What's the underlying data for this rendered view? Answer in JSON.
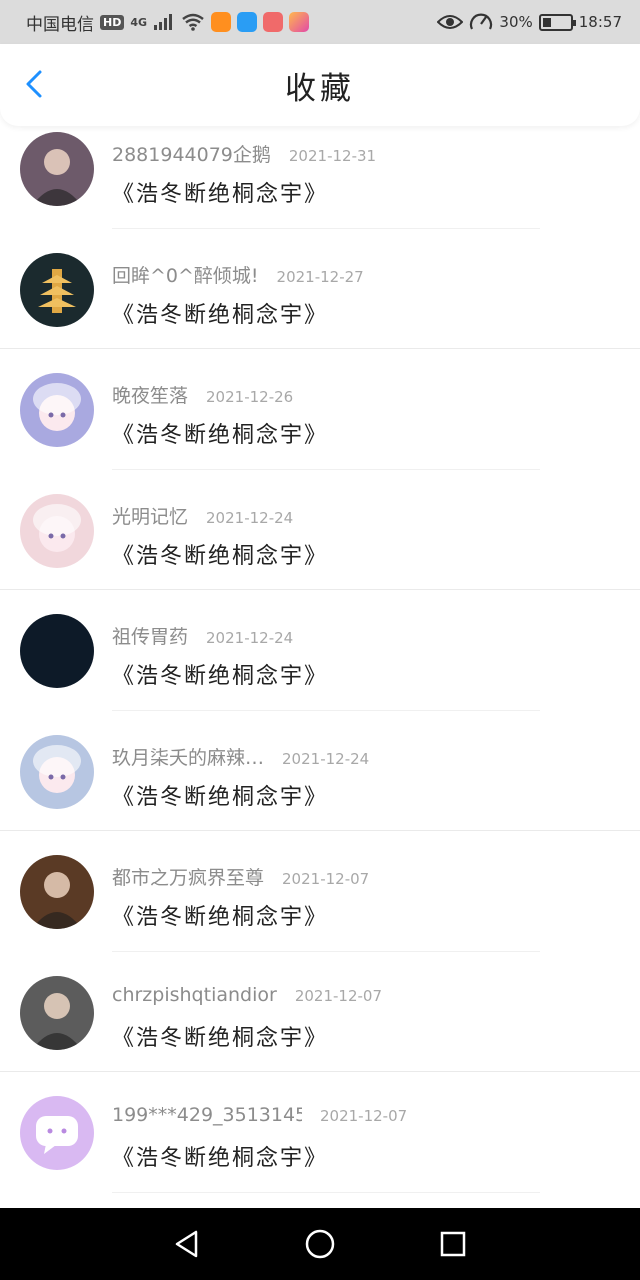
{
  "status_bar": {
    "carrier": "中国电信",
    "hd": "HD",
    "network": "4G",
    "battery_percent": "30%",
    "battery_level": 0.3,
    "time": "18:57"
  },
  "header": {
    "title": "收藏"
  },
  "favorites": [
    {
      "username": "2881944079企鹅",
      "date": "2021-12-31",
      "title": "《浩冬断绝桐念宇》",
      "avatar_icon": "photo-avatar",
      "avatar_color": "#6d5a6a"
    },
    {
      "username": "回眸^0^醉倾城!",
      "date": "2021-12-27",
      "title": "《浩冬断绝桐念宇》",
      "avatar_icon": "pagoda-night-avatar",
      "avatar_color": "#1b2a2e"
    },
    {
      "username": "晚夜笙落",
      "date": "2021-12-26",
      "title": "《浩冬断绝桐念宇》",
      "avatar_icon": "anime-girl-avatar",
      "avatar_color": "#a9a9e0"
    },
    {
      "username": "光明记忆",
      "date": "2021-12-24",
      "title": "《浩冬断绝桐念宇》",
      "avatar_icon": "anime-girl-avatar",
      "avatar_color": "#f1d7dc"
    },
    {
      "username": "祖传胃药",
      "date": "2021-12-24",
      "title": "《浩冬断绝桐念宇》",
      "avatar_icon": "dark-avatar",
      "avatar_color": "#0d1a28"
    },
    {
      "username": "玖月柒夭的麻辣…",
      "date": "2021-12-24",
      "title": "《浩冬断绝桐念宇》",
      "avatar_icon": "anime-girl-avatar",
      "avatar_color": "#b7c6e2"
    },
    {
      "username": "都市之万疯界至尊",
      "date": "2021-12-07",
      "title": "《浩冬断绝桐念宇》",
      "avatar_icon": "photo-avatar",
      "avatar_color": "#5a3a25"
    },
    {
      "username": "chrzpishqtiandior",
      "date": "2021-12-07",
      "title": "《浩冬断绝桐念宇》",
      "avatar_icon": "photo-avatar",
      "avatar_color": "#5c5c5c"
    },
    {
      "username": "199***429_3513145…",
      "date": "2021-12-07",
      "title": "《浩冬断绝桐念宇》",
      "avatar_icon": "chat-bubble-avatar",
      "avatar_color": "#d9b9f2"
    }
  ],
  "nav_bar": {
    "back_icon": "triangle-back-icon",
    "home_icon": "circle-home-icon",
    "recents_icon": "square-recents-icon"
  },
  "colors": {
    "accent": "#1e90ff",
    "status_bar_bg": "#dcdcdc",
    "nav_bg": "#000000"
  }
}
